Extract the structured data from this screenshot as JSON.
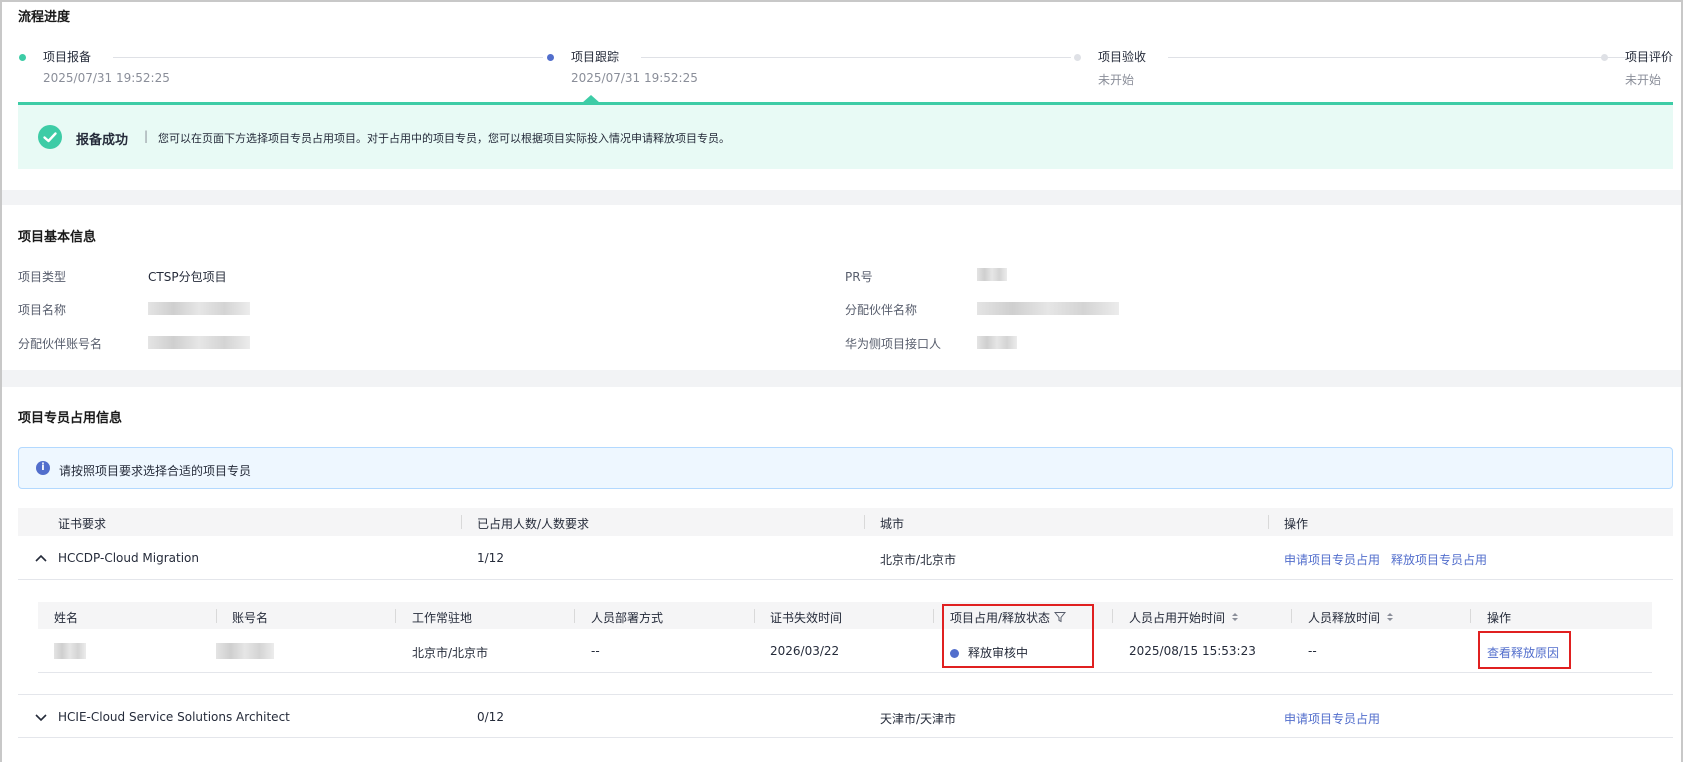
{
  "progress": {
    "title": "流程进度",
    "steps": [
      {
        "name": "项目报备",
        "time": "2025/07/31 19:52:25"
      },
      {
        "name": "项目跟踪",
        "time": "2025/07/31 19:52:25"
      },
      {
        "name": "项目验收",
        "time": "未开始"
      },
      {
        "name": "项目评价",
        "time": "未开始"
      }
    ],
    "success_title": "报备成功",
    "success_sep": "|",
    "success_desc": "您可以在页面下方选择项目专员占用项目。对于占用中的项目专员，您可以根据项目实际投入情况申请释放项目专员。"
  },
  "basic": {
    "title": "项目基本信息",
    "fields": [
      {
        "label": "项目类型",
        "value": "CTSP分包项目"
      },
      {
        "label": "项目名称",
        "value": ""
      },
      {
        "label": "分配伙伴账号名",
        "value": ""
      },
      {
        "label": "PR号",
        "value": ""
      },
      {
        "label": "分配伙伴名称",
        "value": ""
      },
      {
        "label": "华为侧项目接口人",
        "value": ""
      }
    ]
  },
  "members": {
    "title": "项目专员占用信息",
    "info": "请按照项目要求选择合适的项目专员",
    "columns": [
      "证书要求",
      "已占用人数/人数要求",
      "城市",
      "操作"
    ],
    "rows": [
      {
        "cert": "HCCDP-Cloud Migration",
        "count": "1/12",
        "city": "北京市/北京市",
        "action1": "申请项目专员占用",
        "action2": "释放项目专员占用"
      },
      {
        "cert": "HCIE-Cloud Service Solutions Architect",
        "count": "0/12",
        "city": "天津市/天津市",
        "action1": "申请项目专员占用"
      }
    ],
    "sub_columns": [
      "姓名",
      "账号名",
      "工作常驻地",
      "人员部署方式",
      "证书失效时间",
      "项目占用/释放状态",
      "人员占用开始时间",
      "人员释放时间",
      "操作"
    ],
    "sub_row": {
      "location": "北京市/北京市",
      "deploy": "--",
      "expire": "2026/03/22",
      "status": "释放审核中",
      "start": "2025/08/15 15:53:23",
      "release": "--",
      "action": "查看释放原因"
    }
  },
  "colors": {
    "accent": "#3dcca6",
    "link": "#526ecc",
    "highlight": "#e02020"
  }
}
